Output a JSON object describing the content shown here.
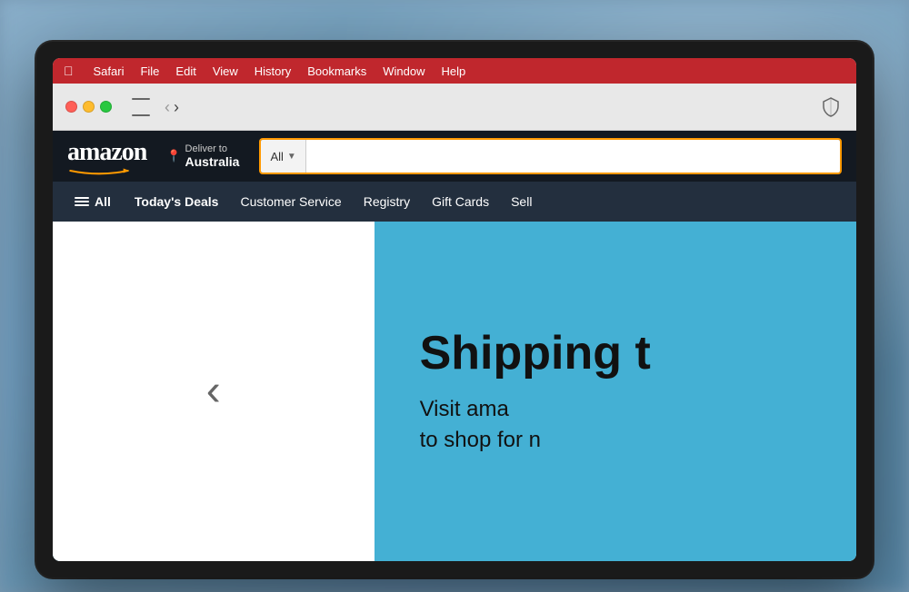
{
  "background": {
    "color": "#7a9bb5"
  },
  "menubar": {
    "apple_label": "",
    "items": [
      {
        "label": "Safari"
      },
      {
        "label": "File"
      },
      {
        "label": "Edit"
      },
      {
        "label": "View"
      },
      {
        "label": "History"
      },
      {
        "label": "Bookmarks"
      },
      {
        "label": "Window"
      },
      {
        "label": "Help"
      }
    ]
  },
  "safari": {
    "back_arrow": "‹",
    "forward_arrow": "›"
  },
  "amazon": {
    "logo_text": "amazon",
    "deliver_to_line1": "Deliver to",
    "deliver_to_line2": "Australia",
    "search_category": "All",
    "nav": {
      "all_label": "All",
      "links": [
        {
          "label": "Today's Deals"
        },
        {
          "label": "Customer Service"
        },
        {
          "label": "Registry"
        },
        {
          "label": "Gift Cards"
        },
        {
          "label": "Sell"
        }
      ]
    },
    "hero": {
      "title": "Shipping t",
      "subtitle_line1": "Visit ama",
      "subtitle_line2": "to shop for n"
    }
  }
}
